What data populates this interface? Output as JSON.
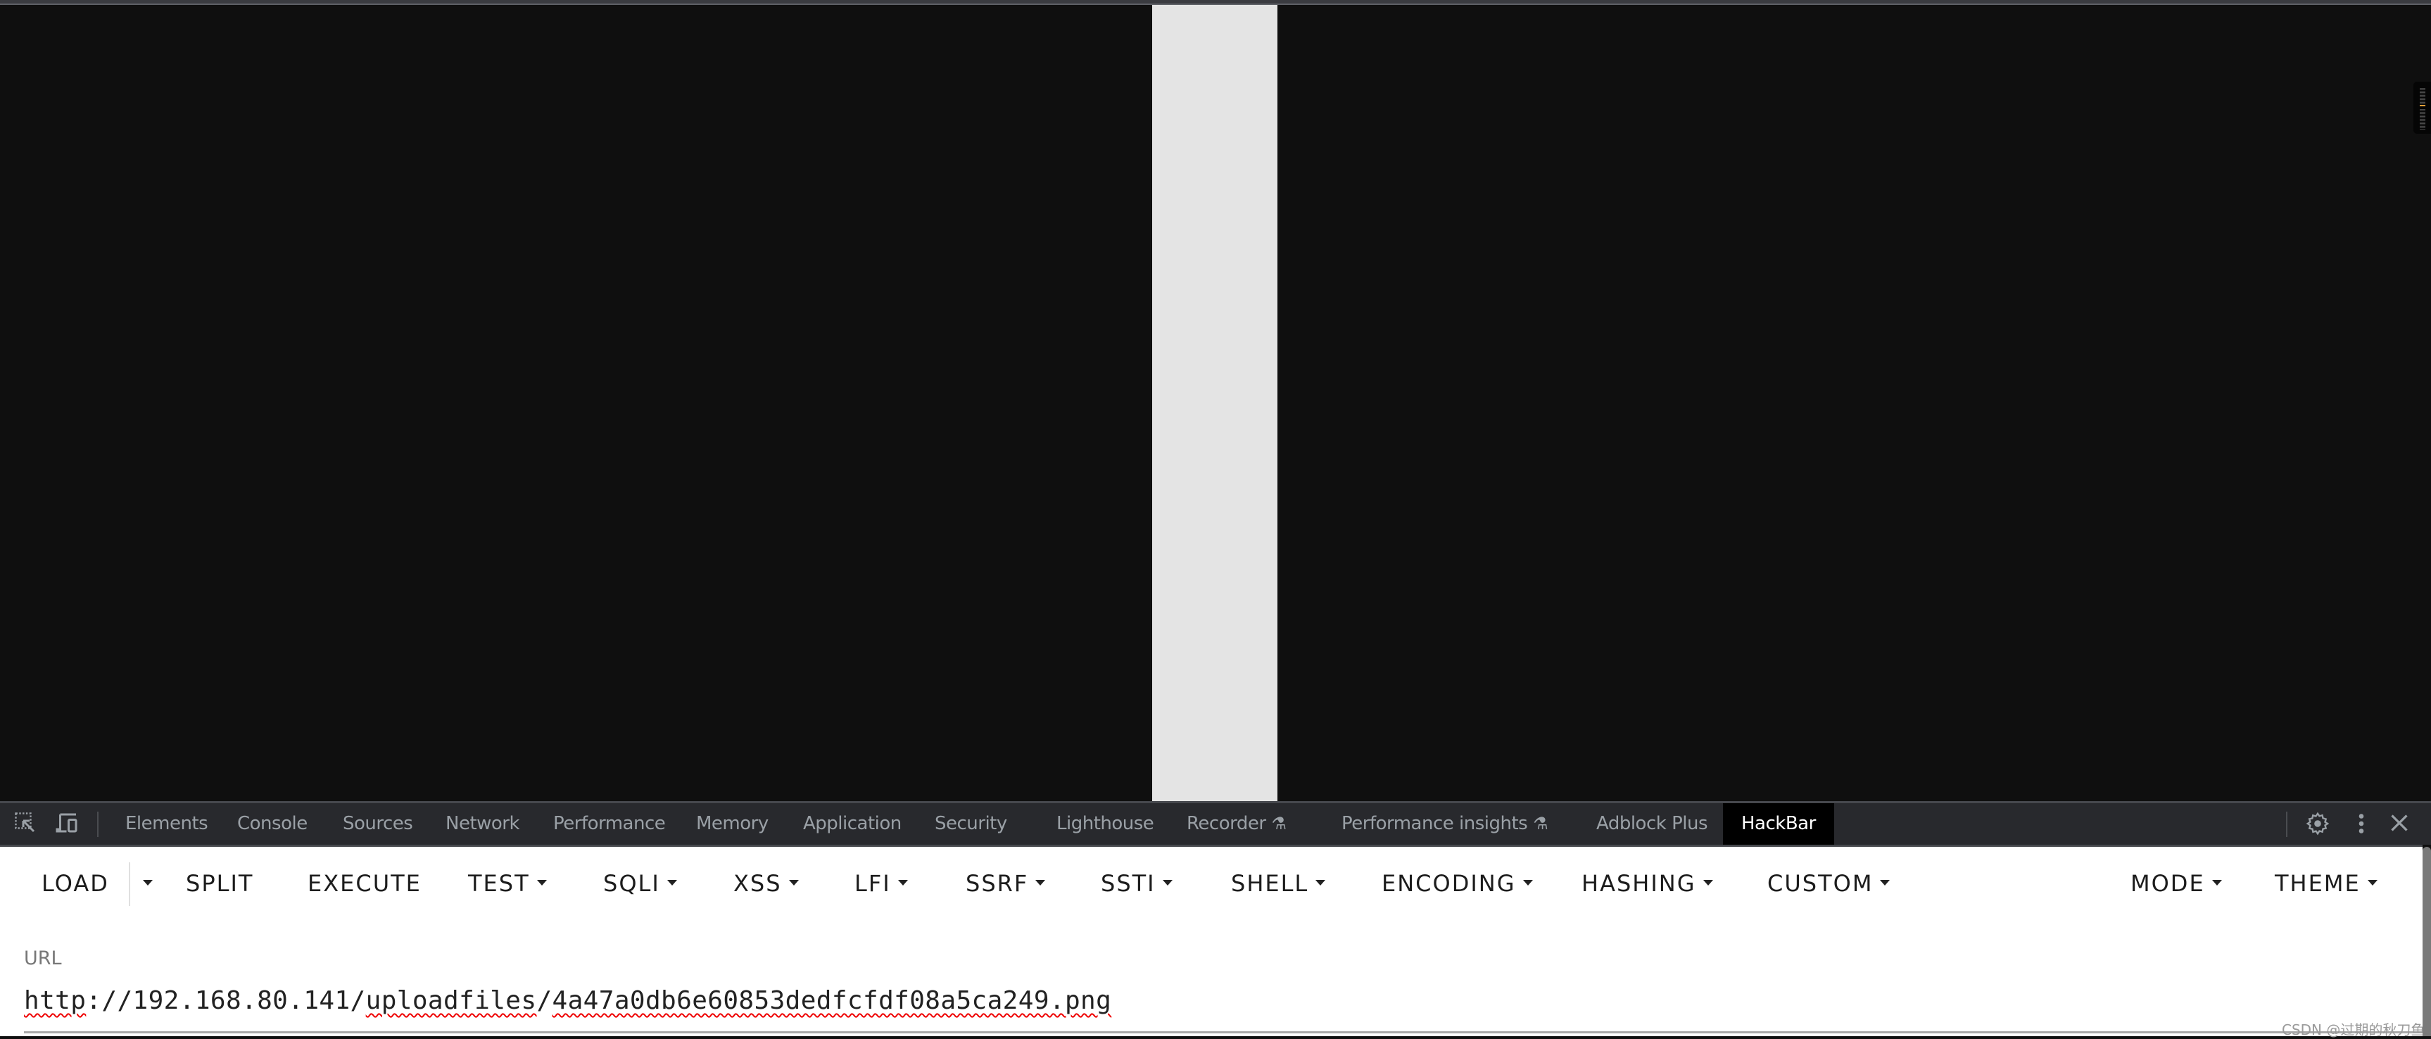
{
  "devtools": {
    "tabs": [
      {
        "label": "Elements"
      },
      {
        "label": "Console"
      },
      {
        "label": "Sources"
      },
      {
        "label": "Network"
      },
      {
        "label": "Performance"
      },
      {
        "label": "Memory"
      },
      {
        "label": "Application"
      },
      {
        "label": "Security"
      },
      {
        "label": "Lighthouse"
      },
      {
        "label": "Recorder",
        "icon": "flask-icon"
      },
      {
        "label": "Performance insights",
        "icon": "flask-icon"
      },
      {
        "label": "Adblock Plus"
      },
      {
        "label": "HackBar",
        "active": true
      }
    ],
    "left_icons": [
      "inspect-element-icon",
      "device-toggle-icon"
    ],
    "right_icons": [
      "gear-icon",
      "kebab-menu-icon",
      "close-icon"
    ],
    "flask_glyph": "⚗"
  },
  "hackbar": {
    "menu": [
      {
        "label": "LOAD"
      },
      {
        "label": "SPLIT"
      },
      {
        "label": "EXECUTE"
      },
      {
        "label": "TEST",
        "dropdown": true
      },
      {
        "label": "SQLI",
        "dropdown": true
      },
      {
        "label": "XSS",
        "dropdown": true
      },
      {
        "label": "LFI",
        "dropdown": true
      },
      {
        "label": "SSRF",
        "dropdown": true
      },
      {
        "label": "SSTI",
        "dropdown": true
      },
      {
        "label": "SHELL",
        "dropdown": true
      },
      {
        "label": "ENCODING",
        "dropdown": true
      },
      {
        "label": "HASHING",
        "dropdown": true
      },
      {
        "label": "CUSTOM",
        "dropdown": true
      },
      {
        "label": "MODE",
        "dropdown": true
      },
      {
        "label": "THEME",
        "dropdown": true
      }
    ],
    "url_label": "URL",
    "url_parts": {
      "p1": "http",
      "p2": "://192.168.80.141/",
      "p3": "uploadfiles",
      "p4": "/",
      "p5": "4a47a0db6e60853dedfcfdf08a5ca249.png"
    },
    "url_value": "http://192.168.80.141/uploadfiles/4a47a0db6e60853dedfcfdf08a5ca249.png"
  },
  "watermark": "CSDN @过期的秋刀鱼-",
  "colors": {
    "page_bg": "#0f0f0f",
    "light_column": "#e4e4e4",
    "devtools_bg": "#28292d",
    "active_tab_bg": "#000000",
    "minimap_highlight": "#e8a13a",
    "spellcheck": "#e00000"
  }
}
